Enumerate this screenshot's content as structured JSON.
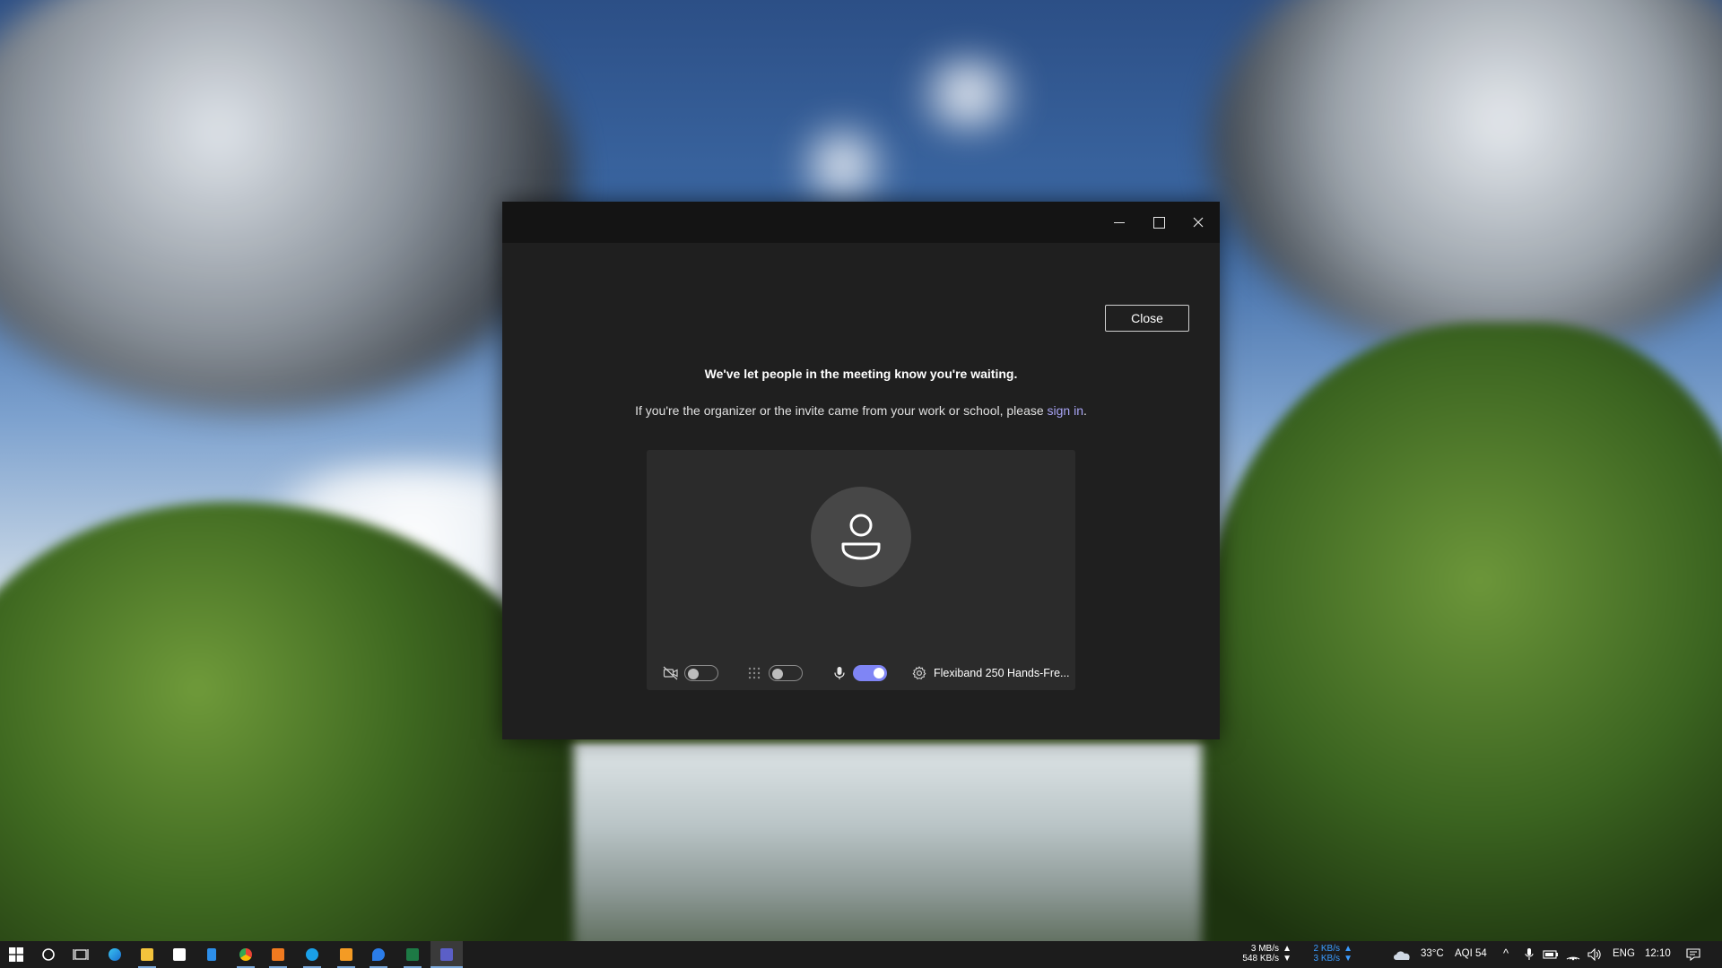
{
  "window": {
    "close_button_label": "Close",
    "heading": "We've let people in the meeting know you're waiting.",
    "subline_before_link": "If you're the organizer or the invite came from your work or school, please ",
    "signin_link_label": "sign in",
    "subline_after_link": ".",
    "controls": {
      "video_enabled": false,
      "blur_enabled": false,
      "mic_enabled": true,
      "device_label": "Flexiband 250 Hands-Fre..."
    }
  },
  "taskbar": {
    "net_up": "3 MB/s",
    "net_down": "548 KB/s",
    "net2_up": "2 KB/s",
    "net2_down": "3 KB/s",
    "weather": "33°C",
    "aqi": "AQI 54",
    "language": "ENG",
    "time": "12:10",
    "apps": [
      "edge",
      "file-explorer",
      "store",
      "notepad",
      "chrome",
      "app-orange",
      "skype",
      "sublime",
      "maps",
      "excel",
      "teams"
    ]
  },
  "colors": {
    "accent": "#7f85f5",
    "link": "#a8a4f5",
    "window_bg": "#1f1f1f",
    "titlebar_bg": "#141414",
    "preview_bg": "#2b2b2b",
    "net_blue": "#3b9cff"
  }
}
